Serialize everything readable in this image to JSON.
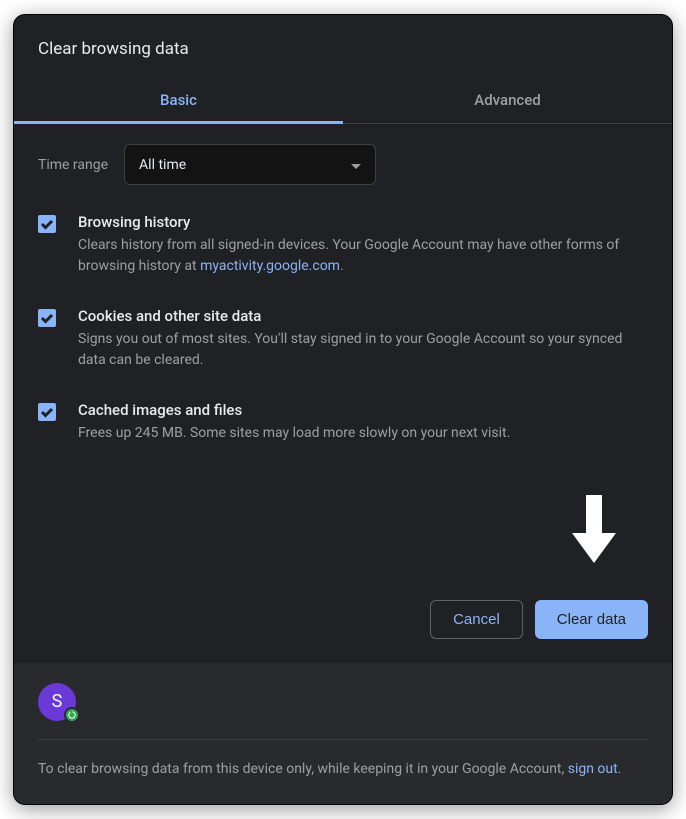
{
  "dialog": {
    "title": "Clear browsing data",
    "tabs": {
      "basic": "Basic",
      "advanced": "Advanced"
    },
    "time_range": {
      "label": "Time range",
      "value": "All time"
    },
    "options": {
      "browsing_history": {
        "title": "Browsing history",
        "desc_prefix": "Clears history from all signed-in devices. Your Google Account may have other forms of browsing history at ",
        "link": "myactivity.google.com",
        "desc_suffix": "."
      },
      "cookies": {
        "title": "Cookies and other site data",
        "desc": "Signs you out of most sites. You'll stay signed in to your Google Account so your synced data can be cleared."
      },
      "cache": {
        "title": "Cached images and files",
        "desc": "Frees up 245 MB. Some sites may load more slowly on your next visit."
      }
    },
    "buttons": {
      "cancel": "Cancel",
      "clear": "Clear data"
    }
  },
  "footer": {
    "avatar_letter": "S",
    "text_prefix": "To clear browsing data from this device only, while keeping it in your Google Account, ",
    "link": "sign out",
    "text_suffix": "."
  }
}
